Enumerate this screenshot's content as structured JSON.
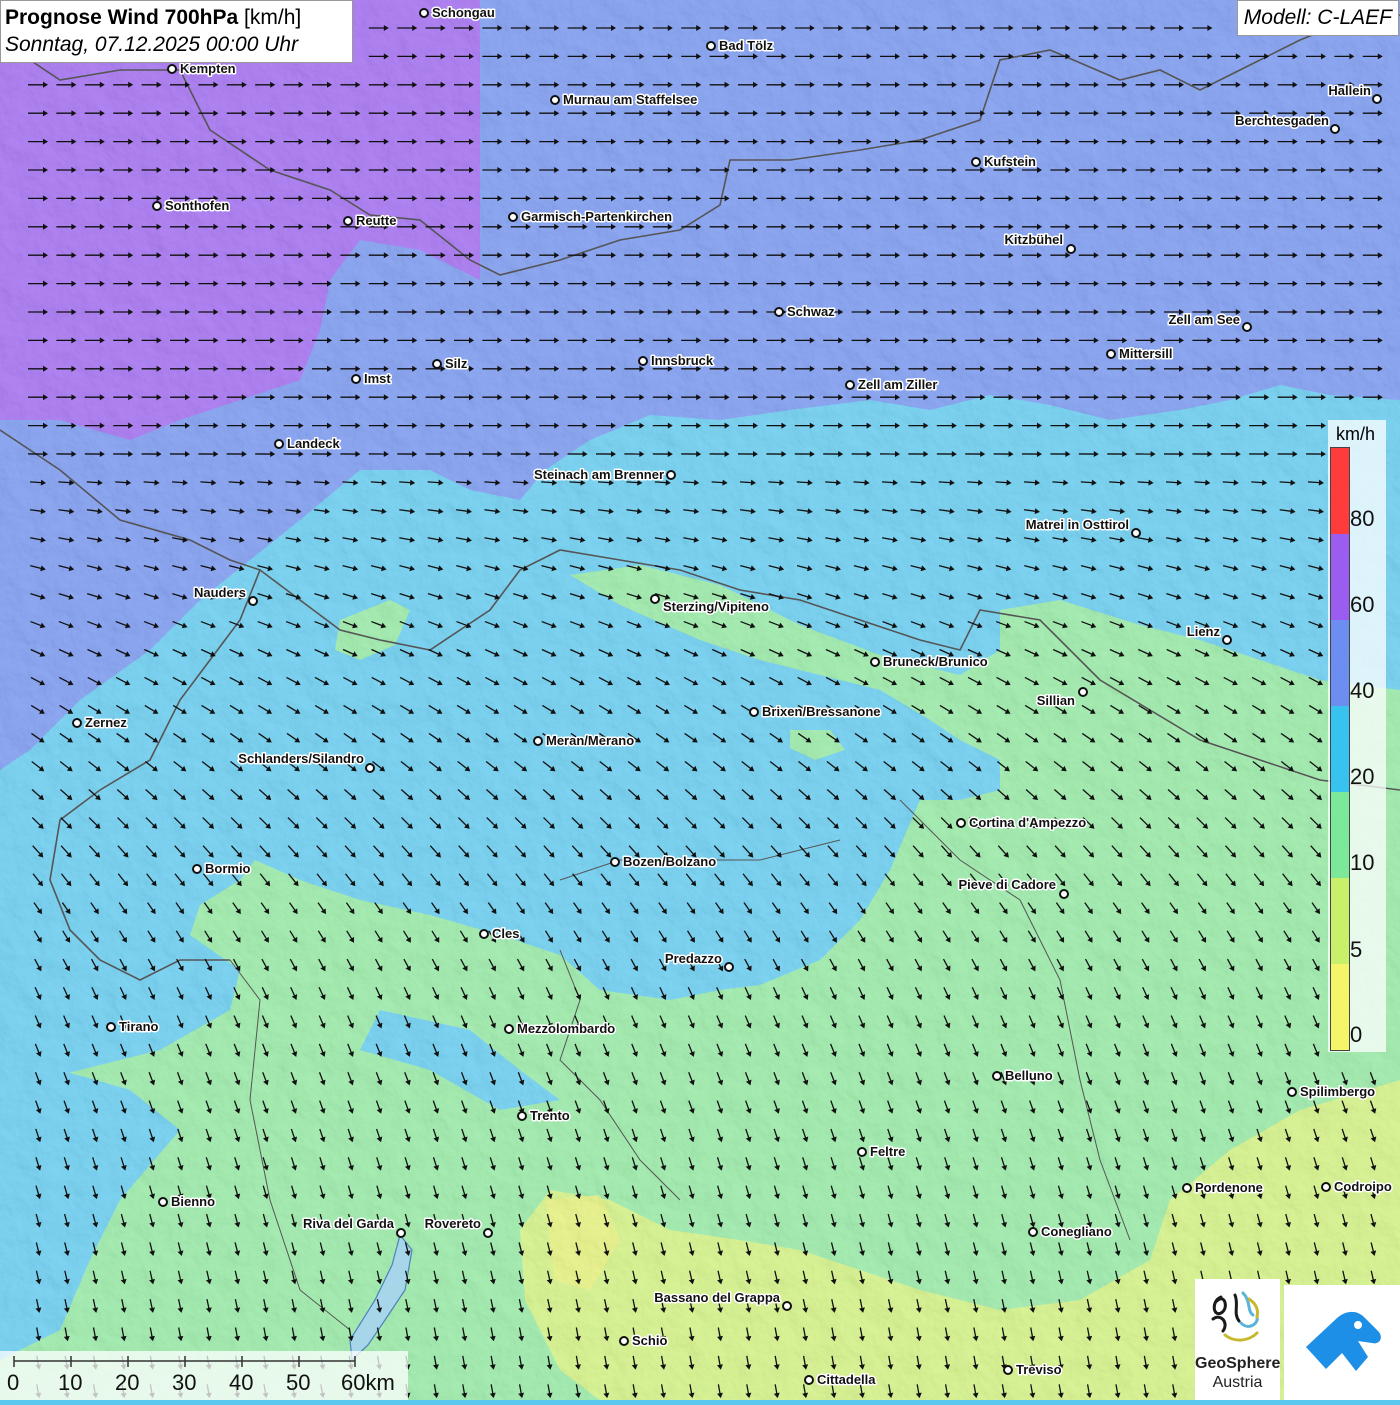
{
  "title": {
    "bold": "Prognose Wind 700hPa",
    "unit": " [km/h]",
    "date": "Sonntag, 07.12.2025 00:00 Uhr"
  },
  "model": "Modell: C-LAEF",
  "legend": {
    "unit": "km/h",
    "ticks": [
      "80",
      "60",
      "40",
      "20",
      "10",
      "5",
      "0"
    ],
    "colors": [
      "#ff3b3b",
      "#9b5cf0",
      "#6b8ef0",
      "#38c2f0",
      "#7ce89a",
      "#c8f06a",
      "#f5f56a"
    ]
  },
  "scale": {
    "labels": [
      "0",
      "10",
      "20",
      "30",
      "40",
      "50",
      "60km"
    ]
  },
  "logos": {
    "geosphere_line1": "GeoSphere",
    "geosphere_line2": "Austria"
  },
  "cities": [
    {
      "name": "Schongau"
    },
    {
      "name": "Kempten"
    },
    {
      "name": "Bad Tölz"
    },
    {
      "name": "Murnau am Staffelsee"
    },
    {
      "name": "Hallein"
    },
    {
      "name": "Berchtesgaden"
    },
    {
      "name": "Kufstein"
    },
    {
      "name": "Sonthofen"
    },
    {
      "name": "Reutte"
    },
    {
      "name": "Garmisch-Partenkirchen"
    },
    {
      "name": "Kitzbühel"
    },
    {
      "name": "Schwaz"
    },
    {
      "name": "Zell am See"
    },
    {
      "name": "Mittersill"
    },
    {
      "name": "Silz"
    },
    {
      "name": "Innsbruck"
    },
    {
      "name": "Imst"
    },
    {
      "name": "Zell am Ziller"
    },
    {
      "name": "Landeck"
    },
    {
      "name": "Steinach am Brenner"
    },
    {
      "name": "Matrei in Osttirol"
    },
    {
      "name": "Nauders"
    },
    {
      "name": "Sterzing/Vipiteno"
    },
    {
      "name": "Lienz"
    },
    {
      "name": "Bruneck/Brunico"
    },
    {
      "name": "Sillian"
    },
    {
      "name": "Zernez"
    },
    {
      "name": "Brixen/Bressanone"
    },
    {
      "name": "Meran/Merano"
    },
    {
      "name": "Schlanders/Silandro"
    },
    {
      "name": "Cortina d'Ampezzo"
    },
    {
      "name": "Bozen/Bolzano"
    },
    {
      "name": "Bormio"
    },
    {
      "name": "Pieve di Cadore"
    },
    {
      "name": "Cles"
    },
    {
      "name": "Predazzo"
    },
    {
      "name": "Tirano"
    },
    {
      "name": "Mezzolombardo"
    },
    {
      "name": "Belluno"
    },
    {
      "name": "Spilimbergo"
    },
    {
      "name": "Trento"
    },
    {
      "name": "Feltre"
    },
    {
      "name": "Pordenone"
    },
    {
      "name": "Codroipo"
    },
    {
      "name": "Bienno"
    },
    {
      "name": "Riva del Garda"
    },
    {
      "name": "Rovereto"
    },
    {
      "name": "Conegliano"
    },
    {
      "name": "Bassano del Grappa"
    },
    {
      "name": "Schio"
    },
    {
      "name": "Treviso"
    },
    {
      "name": "Cittadella"
    }
  ]
}
